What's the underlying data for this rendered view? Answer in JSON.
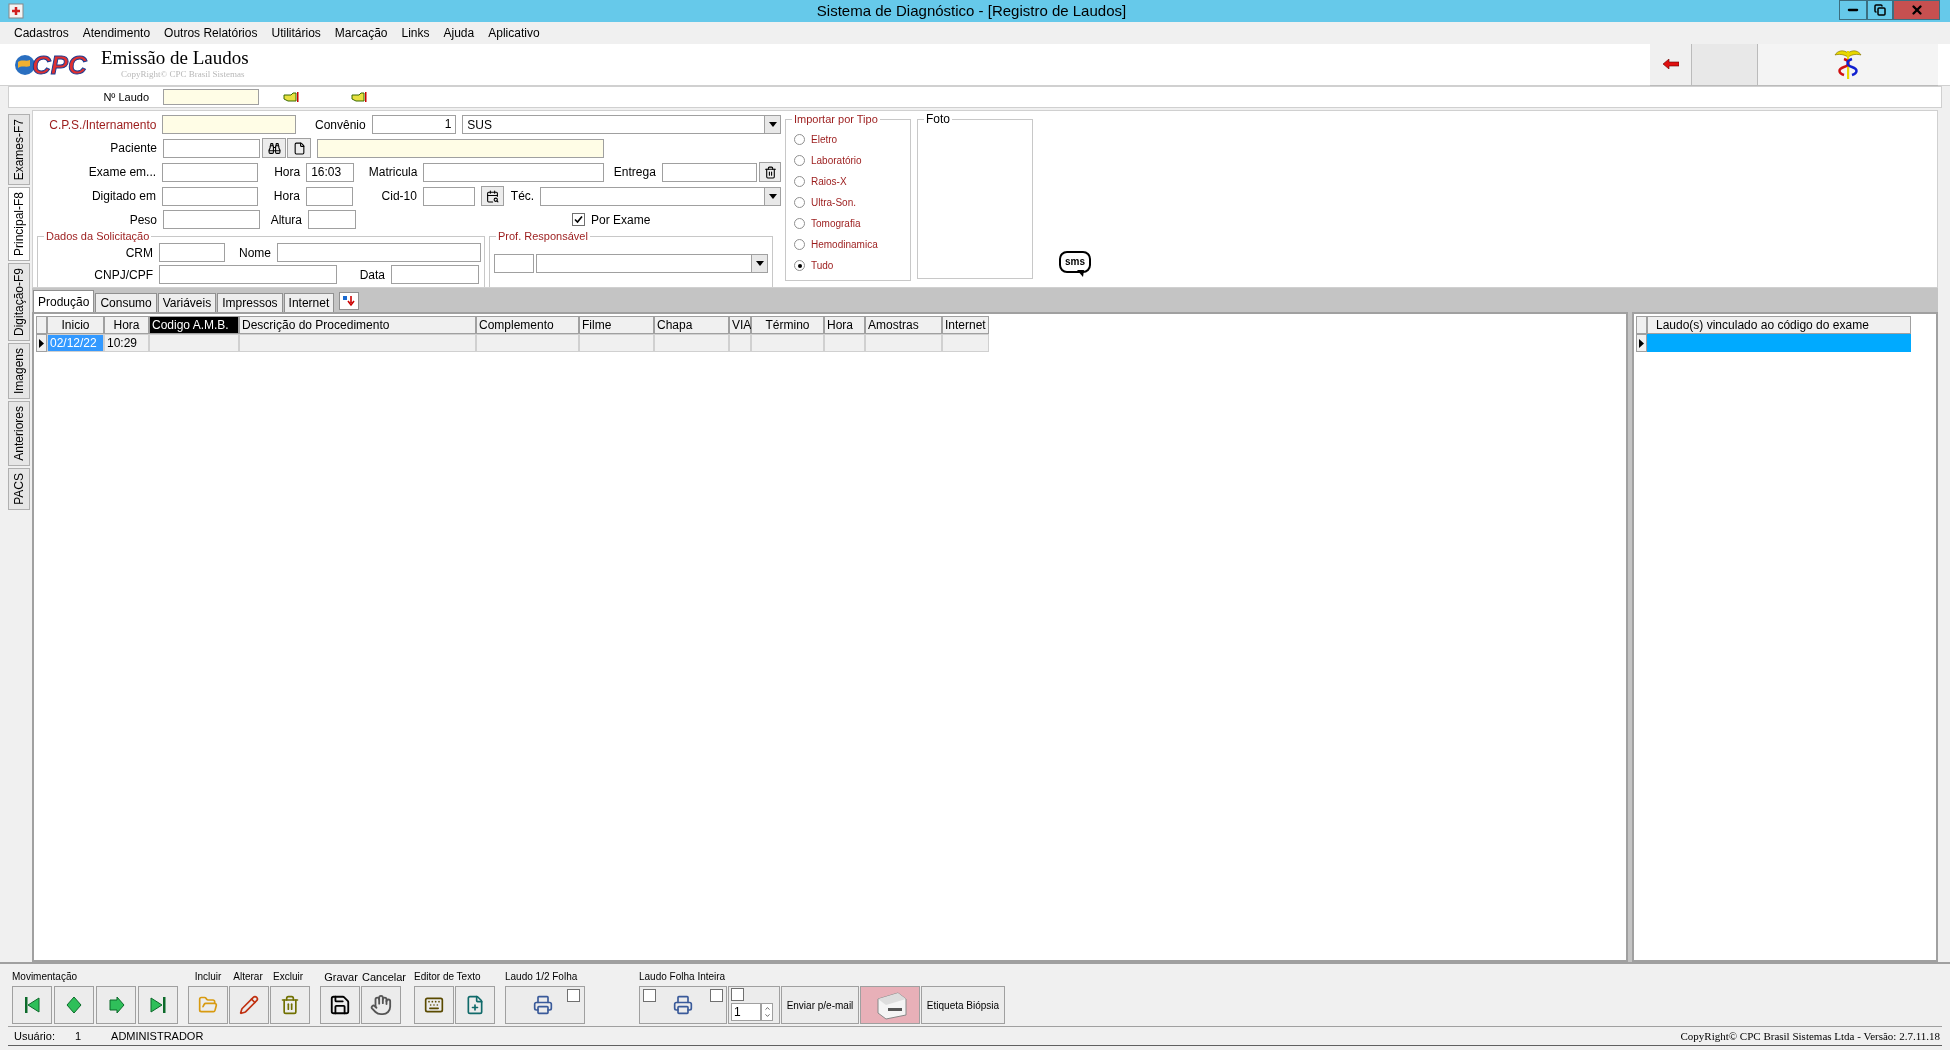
{
  "window": {
    "title": "Sistema de Diagnóstico - [Registro de Laudos]"
  },
  "menu": [
    "Cadastros",
    "Atendimento",
    "Outros Relatórios",
    "Utilitários",
    "Marcação",
    "Links",
    "Ajuda",
    "Aplicativo"
  ],
  "header": {
    "logo": "CPC",
    "title": "Emissão de Laudos",
    "copyright": "CopyRight© CPC Brasil Sistemas"
  },
  "laudo": {
    "label": "Nº Laudo"
  },
  "side_tabs": [
    {
      "label": "Exames-F7",
      "selected": false
    },
    {
      "label": "Principal-F8",
      "selected": true
    },
    {
      "label": "Digitação-F9",
      "selected": false
    },
    {
      "label": "Imagens",
      "selected": false
    },
    {
      "label": "Anteriores",
      "selected": false
    },
    {
      "label": "PACS",
      "selected": false
    }
  ],
  "form": {
    "cps": {
      "label": "C.P.S./Internamento"
    },
    "convenio": {
      "label": "Convênio",
      "code": "1",
      "value": "SUS"
    },
    "paciente": {
      "label": "Paciente"
    },
    "exame_em": {
      "label": "Exame em..."
    },
    "hora_exame": {
      "label": "Hora",
      "value": "16:03"
    },
    "matricula": {
      "label": "Matricula"
    },
    "entrega": {
      "label": "Entrega"
    },
    "digitado_em": {
      "label": "Digitado em"
    },
    "hora_digitado": {
      "label": "Hora"
    },
    "cid10": {
      "label": "Cid-10"
    },
    "tec": {
      "label": "Téc."
    },
    "peso": {
      "label": "Peso"
    },
    "altura": {
      "label": "Altura"
    },
    "por_exame": {
      "label": "Por Exame",
      "checked": true
    },
    "solicitacao": {
      "title": "Dados da Solicitação",
      "crm": "CRM",
      "nome": "Nome",
      "cnpj": "CNPJ/CPF",
      "data": "Data"
    },
    "prof": {
      "title": "Prof. Responsável"
    }
  },
  "import_group": {
    "title": "Importar por Tipo",
    "options": [
      {
        "label": "Eletro",
        "selected": false
      },
      {
        "label": "Laboratório",
        "selected": false
      },
      {
        "label": "Raios-X",
        "selected": false
      },
      {
        "label": "Ultra-Son.",
        "selected": false
      },
      {
        "label": "Tomografia",
        "selected": false
      },
      {
        "label": "Hemodinamica",
        "selected": false
      },
      {
        "label": "Tudo",
        "selected": true
      }
    ]
  },
  "photo": {
    "title": "Foto"
  },
  "sms": "sms",
  "tabs": [
    {
      "label": "Produção",
      "selected": true
    },
    {
      "label": "Consumo",
      "selected": false
    },
    {
      "label": "Variáveis",
      "selected": false
    },
    {
      "label": "Impressos",
      "selected": false
    },
    {
      "label": "Internet",
      "selected": false
    }
  ],
  "grid": {
    "columns": [
      {
        "label": "Inicio",
        "selected": false
      },
      {
        "label": "Hora",
        "selected": false
      },
      {
        "label": "Codigo A.M.B.",
        "selected": true
      },
      {
        "label": "Descrição do Procedimento",
        "selected": false
      },
      {
        "label": "Complemento",
        "selected": false
      },
      {
        "label": "Filme",
        "selected": false
      },
      {
        "label": "Chapa",
        "selected": false
      },
      {
        "label": "VIA",
        "selected": false
      },
      {
        "label": "Término",
        "selected": false
      },
      {
        "label": "Hora",
        "selected": false
      },
      {
        "label": "Amostras",
        "selected": false
      },
      {
        "label": "Internet",
        "selected": false
      }
    ],
    "rows": [
      {
        "selected": true,
        "cells": [
          "02/12/22",
          "10:29"
        ]
      }
    ]
  },
  "linked_panel": {
    "column": "Laudo(s) vinculado ao código do exame",
    "rows": [
      {
        "selected": true
      }
    ]
  },
  "toolbar": {
    "movimentacao": "Movimentação",
    "edit_labels": [
      "Incluir",
      "Alterar",
      "Excluir"
    ],
    "save_labels": [
      "Gravar",
      "Cancelar"
    ],
    "editor": "Editor de Texto",
    "half": {
      "title": "Laudo 1/2 Folha",
      "checked": false
    },
    "full": {
      "title": "Laudo Folha Inteira",
      "checks": [
        {
          "checked": false
        },
        {
          "checked": false
        },
        {
          "checked": false
        }
      ],
      "copies": "1"
    },
    "email": "Enviar p/e-mail",
    "biopsia": "Etiqueta Biópsia"
  },
  "status": {
    "user_label": "Usuário:",
    "user_id": "1",
    "user_name": "ADMINISTRADOR",
    "copyright": "CopyRight© CPC Brasil Sistemas Ltda - Versão: 2.7.11.18"
  }
}
